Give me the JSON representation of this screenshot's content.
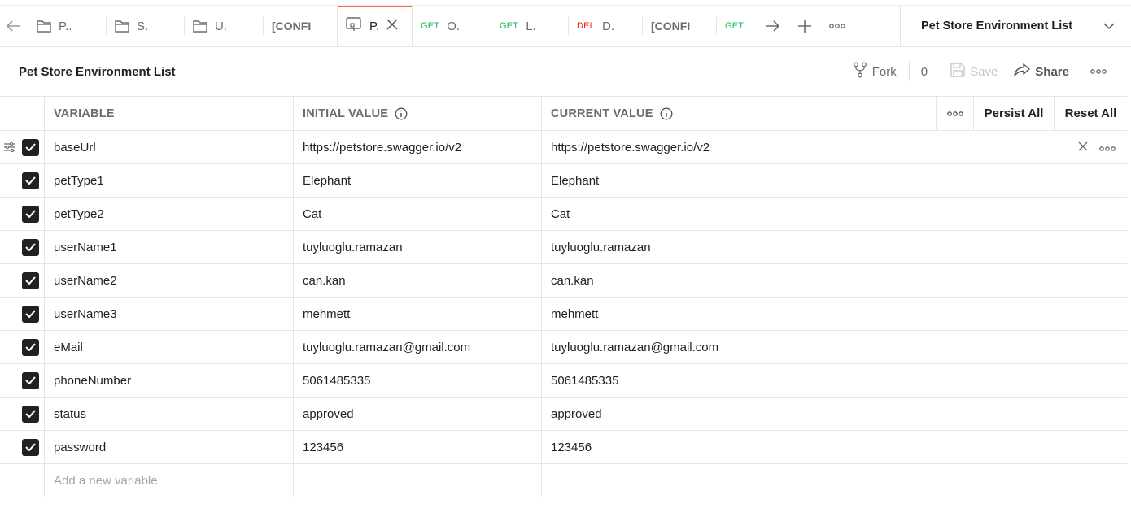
{
  "tabs": [
    {
      "kind": "folder",
      "label": "P.."
    },
    {
      "kind": "folder",
      "label": "S."
    },
    {
      "kind": "folder",
      "label": "U."
    },
    {
      "kind": "config",
      "label": "[CONFI"
    },
    {
      "kind": "env",
      "label": "P.",
      "active": true
    },
    {
      "kind": "request",
      "method": "GET",
      "label": "O."
    },
    {
      "kind": "request",
      "method": "GET",
      "label": "L."
    },
    {
      "kind": "request",
      "method": "DEL",
      "label": "D."
    },
    {
      "kind": "config",
      "label": "[CONFI"
    },
    {
      "kind": "request",
      "method": "GET",
      "label": ""
    }
  ],
  "environment_selector": {
    "label": "Pet Store Environment List"
  },
  "header": {
    "title": "Pet Store Environment List",
    "fork_label": "Fork",
    "fork_count": "0",
    "save_label": "Save",
    "share_label": "Share"
  },
  "table": {
    "col_variable": "VARIABLE",
    "col_initial": "INITIAL VALUE",
    "col_current": "CURRENT VALUE",
    "persist_all": "Persist All",
    "reset_all": "Reset All",
    "add_placeholder": "Add a new variable",
    "rows": [
      {
        "variable": "baseUrl",
        "initial": "https://petstore.swagger.io/v2",
        "current": "https://petstore.swagger.io/v2",
        "checked": true
      },
      {
        "variable": "petType1",
        "initial": "Elephant",
        "current": "Elephant",
        "checked": true
      },
      {
        "variable": "petType2",
        "initial": "Cat",
        "current": "Cat",
        "checked": true
      },
      {
        "variable": "userName1",
        "initial": "tuyluoglu.ramazan",
        "current": "tuyluoglu.ramazan",
        "checked": true
      },
      {
        "variable": "userName2",
        "initial": "can.kan",
        "current": "can.kan",
        "checked": true
      },
      {
        "variable": "userName3",
        "initial": "mehmett",
        "current": "mehmett",
        "checked": true
      },
      {
        "variable": "eMail",
        "initial": "tuyluoglu.ramazan@gmail.com",
        "current": "tuyluoglu.ramazan@gmail.com",
        "checked": true
      },
      {
        "variable": "phoneNumber",
        "initial": "5061485335",
        "current": "5061485335",
        "checked": true
      },
      {
        "variable": "status",
        "initial": "approved",
        "current": "approved",
        "checked": true
      },
      {
        "variable": "password",
        "initial": "123456",
        "current": "123456",
        "checked": true
      }
    ]
  },
  "colors": {
    "accent": "#ff6c37",
    "get": "#0cbb52",
    "delete": "#eb2013",
    "checkbox": "#212121"
  }
}
